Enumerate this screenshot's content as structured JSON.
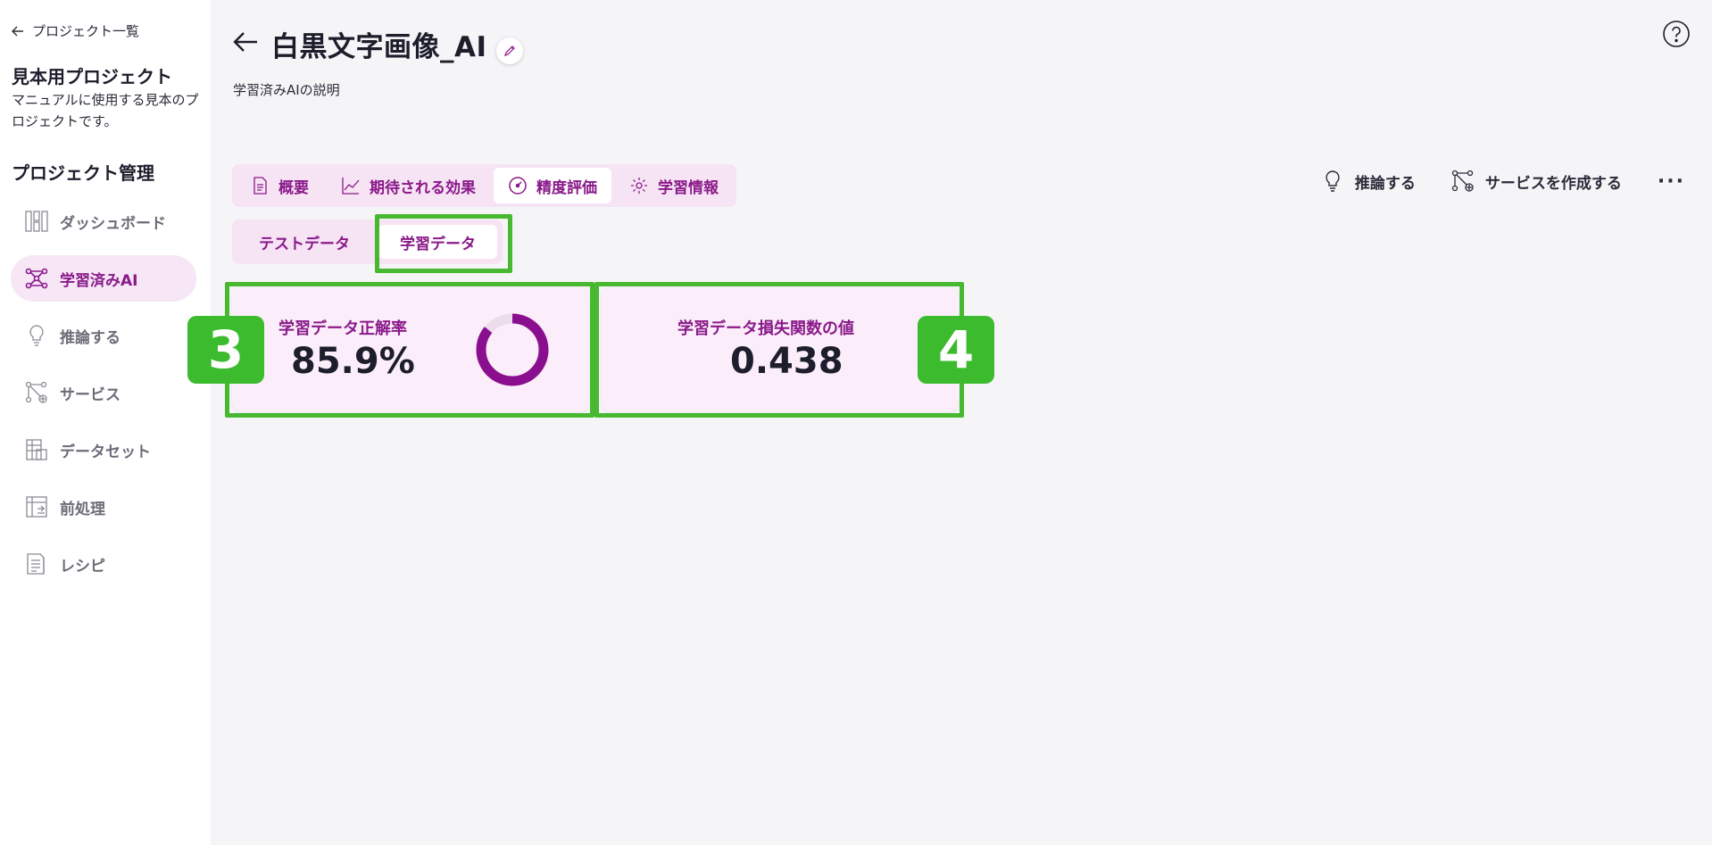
{
  "sidebar": {
    "back_label": "プロジェクト一覧",
    "project_name": "見本用プロジェクト",
    "project_desc": "マニュアルに使用する見本のプロジェクトです。",
    "section_title": "プロジェクト管理",
    "items": [
      {
        "label": "ダッシュボード",
        "icon": "dashboard-icon"
      },
      {
        "label": "学習済みAI",
        "icon": "ai-network-icon",
        "active": true
      },
      {
        "label": "推論する",
        "icon": "lightbulb-icon"
      },
      {
        "label": "サービス",
        "icon": "service-icon"
      },
      {
        "label": "データセット",
        "icon": "dataset-icon"
      },
      {
        "label": "前処理",
        "icon": "preprocess-icon"
      },
      {
        "label": "レシピ",
        "icon": "recipe-icon"
      }
    ]
  },
  "header": {
    "title": "白黒文字画像_AI",
    "subtitle": "学習済みAIの説明"
  },
  "tabs": [
    {
      "label": "概要",
      "icon": "document-icon"
    },
    {
      "label": "期待される効果",
      "icon": "chart-line-icon"
    },
    {
      "label": "精度評価",
      "icon": "gauge-icon",
      "active": true
    },
    {
      "label": "学習情報",
      "icon": "gear-icon"
    }
  ],
  "actions": {
    "infer_label": "推論する",
    "create_service_label": "サービスを作成する",
    "more_label": "···"
  },
  "subtabs": [
    {
      "label": "テストデータ"
    },
    {
      "label": "学習データ",
      "active": true
    }
  ],
  "cards": {
    "accuracy": {
      "label": "学習データ正解率",
      "value": "85.9%",
      "fraction": 0.859
    },
    "loss": {
      "label": "学習データ損失関数の値",
      "value": "0.438"
    }
  },
  "badges": {
    "b3": "3",
    "b4": "4"
  },
  "colors": {
    "accent": "#8a1a8a",
    "highlight": "#48b830",
    "badge": "#3cbb2e",
    "tab_bg": "#f6e3f4"
  }
}
